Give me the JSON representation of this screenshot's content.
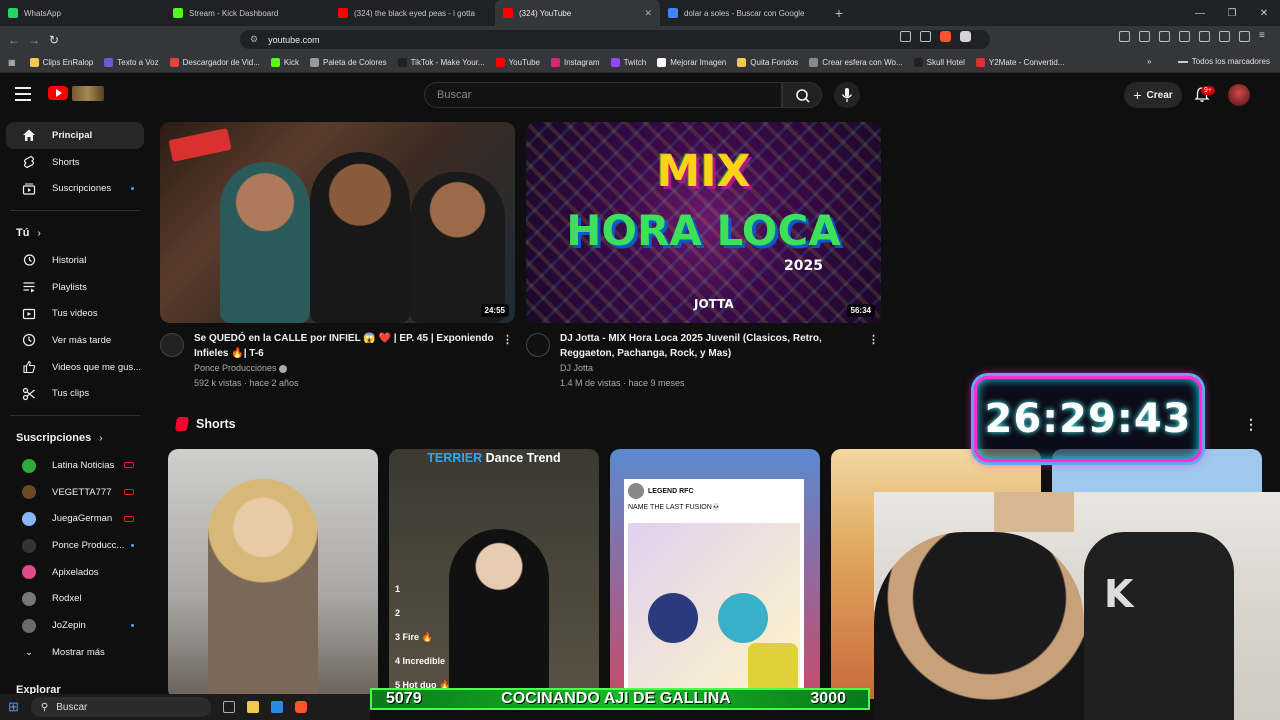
{
  "browser": {
    "tabs": [
      {
        "label": "WhatsApp",
        "color": "#25d366",
        "active": false
      },
      {
        "label": "Stream - Kick Dashboard",
        "color": "#53fc18",
        "active": false
      },
      {
        "label": "(324) the black eyed peas - i gotta",
        "color": "#ff0000",
        "active": false
      },
      {
        "label": "(324) YouTube",
        "color": "#ff0000",
        "active": true
      },
      {
        "label": "dolar a soles - Buscar con Google",
        "color": "#4285f4",
        "active": false
      }
    ],
    "url": "youtube.com",
    "bookmarks": [
      {
        "label": "Clips EnRalop",
        "color": "#f2c94c"
      },
      {
        "label": "Texto a Voz",
        "color": "#6b5bd2"
      },
      {
        "label": "Descargador de Vid...",
        "color": "#e84040"
      },
      {
        "label": "Kick",
        "color": "#53fc18"
      },
      {
        "label": "Paleta de Colores",
        "color": "#999999"
      },
      {
        "label": "TikTok - Make Your...",
        "color": "#222222"
      },
      {
        "label": "YouTube",
        "color": "#ff0000"
      },
      {
        "label": "Instagram",
        "color": "#d62976"
      },
      {
        "label": "Twitch",
        "color": "#9146ff"
      },
      {
        "label": "Mejorar Imagen",
        "color": "#ffffff"
      },
      {
        "label": "Quita Fondos",
        "color": "#f2c94c"
      },
      {
        "label": "Crear esfera con Wo...",
        "color": "#888888"
      },
      {
        "label": "Skull Hotel",
        "color": "#222222"
      },
      {
        "label": "Y2Mate - Convertid...",
        "color": "#d33"
      }
    ],
    "all_bookmarks": "Todos los marcadores"
  },
  "header": {
    "search_placeholder": "Buscar",
    "create_label": "Crear",
    "notif_count": "9+"
  },
  "sidebar": {
    "main": [
      {
        "label": "Principal",
        "icon": "home-icon",
        "active": true
      },
      {
        "label": "Shorts",
        "icon": "shorts-icon"
      },
      {
        "label": "Suscripciones",
        "icon": "subscriptions-icon",
        "dot": true
      }
    ],
    "you_label": "Tú",
    "you": [
      {
        "label": "Historial",
        "icon": "history-icon"
      },
      {
        "label": "Playlists",
        "icon": "playlists-icon"
      },
      {
        "label": "Tus videos",
        "icon": "your-videos-icon"
      },
      {
        "label": "Ver más tarde",
        "icon": "watch-later-icon"
      },
      {
        "label": "Videos que me gus...",
        "icon": "like-icon"
      },
      {
        "label": "Tus clips",
        "icon": "clips-icon"
      }
    ],
    "subs_label": "Suscripciones",
    "subs": [
      {
        "label": "Latina Noticias",
        "color": "#2eaa3a",
        "live": true
      },
      {
        "label": "VEGETTA777",
        "color": "#6b4a2a",
        "live": true
      },
      {
        "label": "JuegaGerman",
        "color": "#8ab4f8",
        "live": true
      },
      {
        "label": "Ponce Producc...",
        "color": "#333333",
        "dot": true
      },
      {
        "label": "Apixelados",
        "color": "#e04a8a"
      },
      {
        "label": "Rodxel",
        "color": "#777777"
      },
      {
        "label": "JoZepin",
        "color": "#6a6a6a",
        "dot": true
      }
    ],
    "show_more": "Mostrar más",
    "explore": "Explorar"
  },
  "videos": [
    {
      "title": "Se QUEDÓ en la CALLE por INFIEL 😱 ❤️ | EP. 45 | Exponiendo Infieles 🔥| T-6",
      "channel": "Ponce Producciones",
      "stats": "592 k vistas · hace 2 años",
      "duration": "24:55"
    },
    {
      "title": "DJ Jotta - MIX Hora Loca 2025 Juvenil (Clasicos, Retro, Reggaeton, Pachanga, Rock, y Mas)",
      "channel": "DJ Jotta",
      "stats": "1.4 M de vistas · hace 9 meses",
      "duration": "56:34",
      "thumb_text": [
        "MIX",
        "HORA LOCA",
        "2025",
        "JOTTA"
      ]
    }
  ],
  "shorts": {
    "label": "Shorts",
    "items": [
      {
        "overlay": ""
      },
      {
        "overlay": "TERRIER Dance Trend",
        "list": [
          "1",
          "2",
          "3 Fire 🔥",
          "4 Incredible",
          "5 Hot duo 🔥"
        ]
      },
      {
        "overlay": "LEGEND RFC",
        "sub": "NAME THE LAST FUSION💀"
      },
      {
        "overlay": ""
      }
    ]
  },
  "overlay": {
    "timer": "26:29:43",
    "cook_left": "5079",
    "cook_title": "COCINANDO AJI DE GALLINA",
    "cook_right": "3000"
  },
  "taskbar": {
    "search": "Buscar"
  }
}
